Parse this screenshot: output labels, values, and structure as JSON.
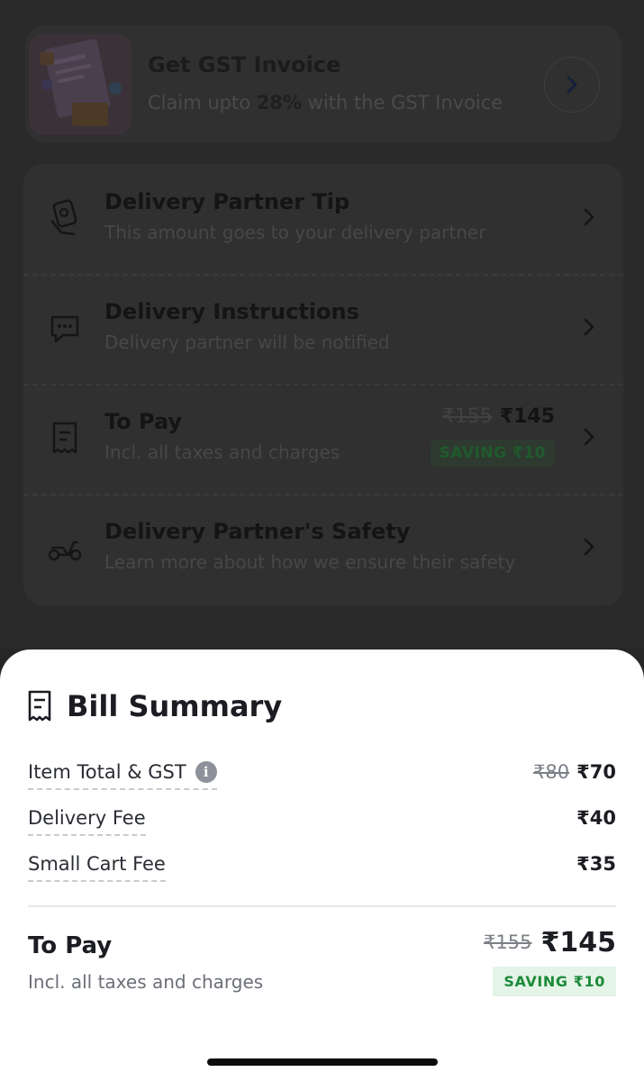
{
  "gst_card": {
    "title": "Get GST Invoice",
    "sub_prefix": "Claim upto ",
    "sub_bold": "28%",
    "sub_suffix": " with the GST Invoice"
  },
  "rows": [
    {
      "title": "Delivery Partner Tip",
      "subtitle": "This amount goes to your delivery partner",
      "icon": "tip-hand-icon"
    },
    {
      "title": "Delivery Instructions",
      "subtitle": "Delivery partner will be notified",
      "icon": "chat-bubble-icon"
    },
    {
      "title": "To Pay",
      "subtitle": "Incl. all taxes and charges",
      "icon": "receipt-icon",
      "price_old": "₹155",
      "price_new": "₹145",
      "saving": "SAVING ₹10"
    },
    {
      "title": "Delivery Partner's Safety",
      "subtitle": "Learn more about how we ensure their safety",
      "icon": "scooter-icon"
    }
  ],
  "bill_summary": {
    "title": "Bill Summary",
    "lines": [
      {
        "label": "Item Total & GST",
        "old": "₹80",
        "value": "₹70",
        "has_info": true
      },
      {
        "label": "Delivery Fee",
        "value": "₹40"
      },
      {
        "label": "Small Cart Fee",
        "value": "₹35"
      }
    ],
    "to_pay": {
      "label": "To Pay",
      "subtitle": "Incl. all taxes and charges",
      "old": "₹155",
      "value": "₹145",
      "saving": "SAVING ₹10"
    }
  },
  "colors": {
    "overlay_bg": "#262626",
    "sheet_bg": "#ffffff",
    "saving_green": "#1d8a3a",
    "saving_bg": "#e4f4e7"
  }
}
